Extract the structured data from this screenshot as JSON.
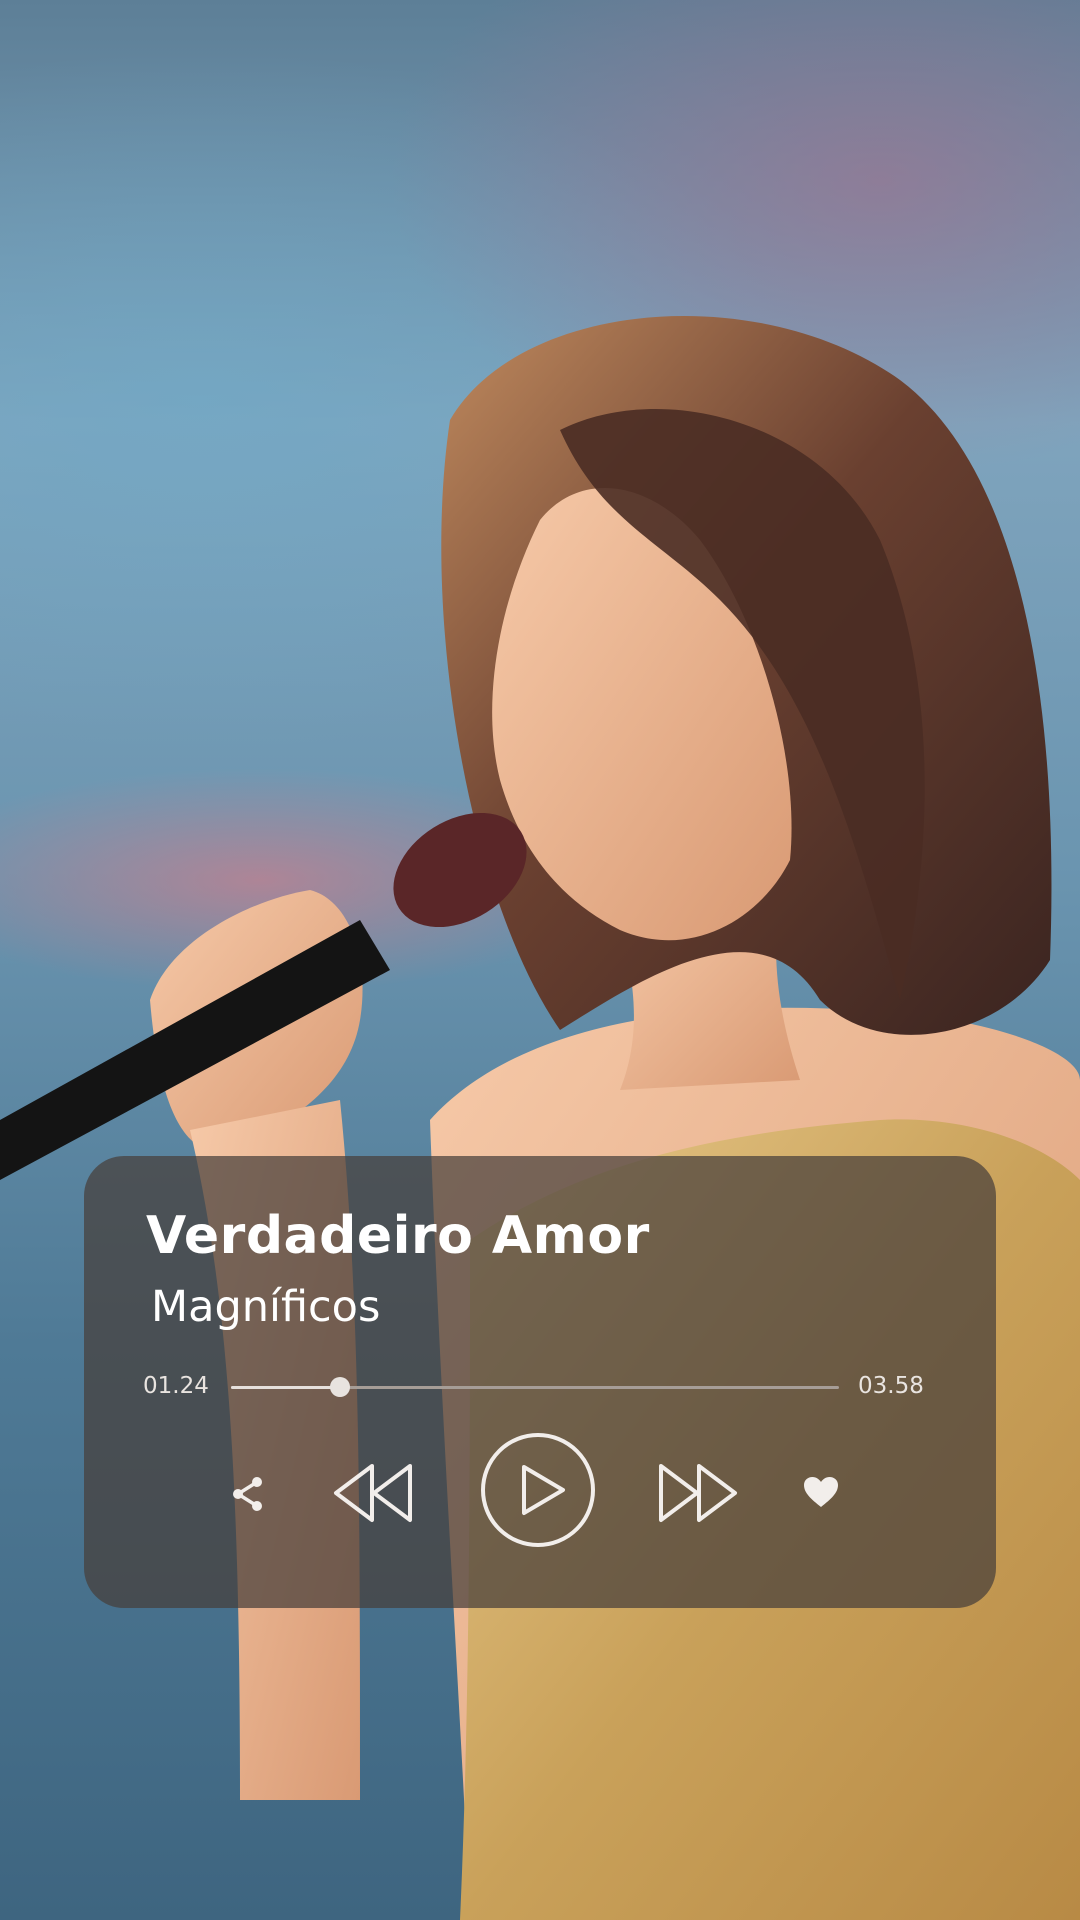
{
  "player": {
    "title": "Verdadeiro Amor",
    "artist": "Magníficos",
    "elapsed": "01.24",
    "duration": "03.58",
    "progress": 0.18
  },
  "controls": {
    "share_icon": "share-icon",
    "rewind_icon": "rewind-icon",
    "play_icon": "play-icon",
    "fast_forward_icon": "fast-forward-icon",
    "like_icon": "heart-icon"
  },
  "colors": {
    "card_background": "#463e3a",
    "text": "#ffffff",
    "icon": "#f2eeeb"
  }
}
